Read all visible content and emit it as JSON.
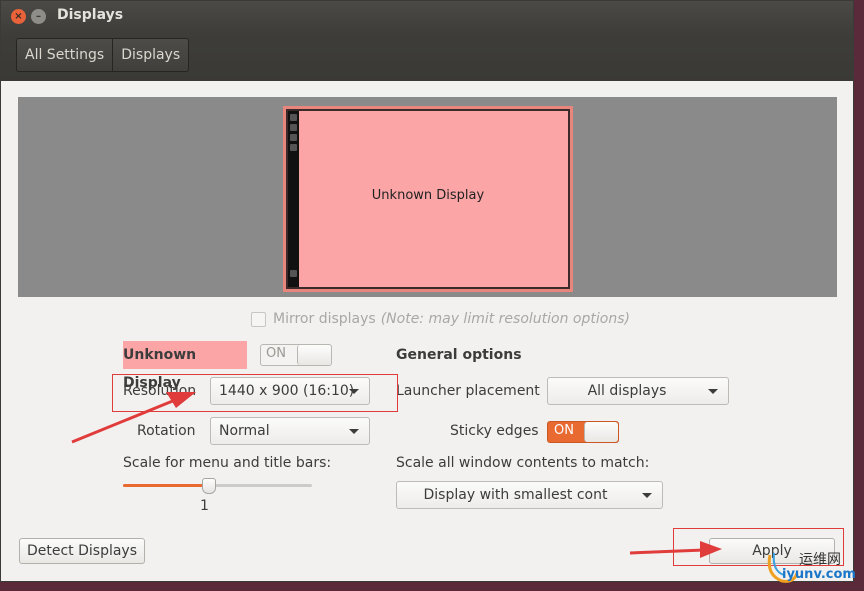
{
  "window": {
    "title": "Displays"
  },
  "breadcrumbs": [
    "All Settings",
    "Displays"
  ],
  "preview": {
    "monitor_label": "Unknown Display"
  },
  "mirror": {
    "label": "Mirror displays",
    "note": "(Note: may limit resolution options)",
    "checked": false
  },
  "display": {
    "name": "Unknown Display",
    "power_label": "ON",
    "resolution_label": "Resolution",
    "resolution_value": "1440 x 900 (16:10)",
    "rotation_label": "Rotation",
    "rotation_value": "Normal",
    "scale_label": "Scale for menu and title bars:",
    "scale_value": "1",
    "scale_fraction": 0.45
  },
  "general": {
    "heading": "General options",
    "launcher_label": "Launcher placement",
    "launcher_value": "All displays",
    "sticky_label": "Sticky edges",
    "sticky_state": "ON",
    "scale_all_label": "Scale all window contents to match:",
    "scale_all_value": "Display with smallest cont"
  },
  "buttons": {
    "detect": "Detect Displays",
    "apply": "Apply"
  },
  "watermark": {
    "top": "运维网",
    "bottom": "iyunv.com"
  },
  "colors": {
    "accent": "#e86a30",
    "highlight": "#fca5a6",
    "annotation": "#e03c3c"
  }
}
